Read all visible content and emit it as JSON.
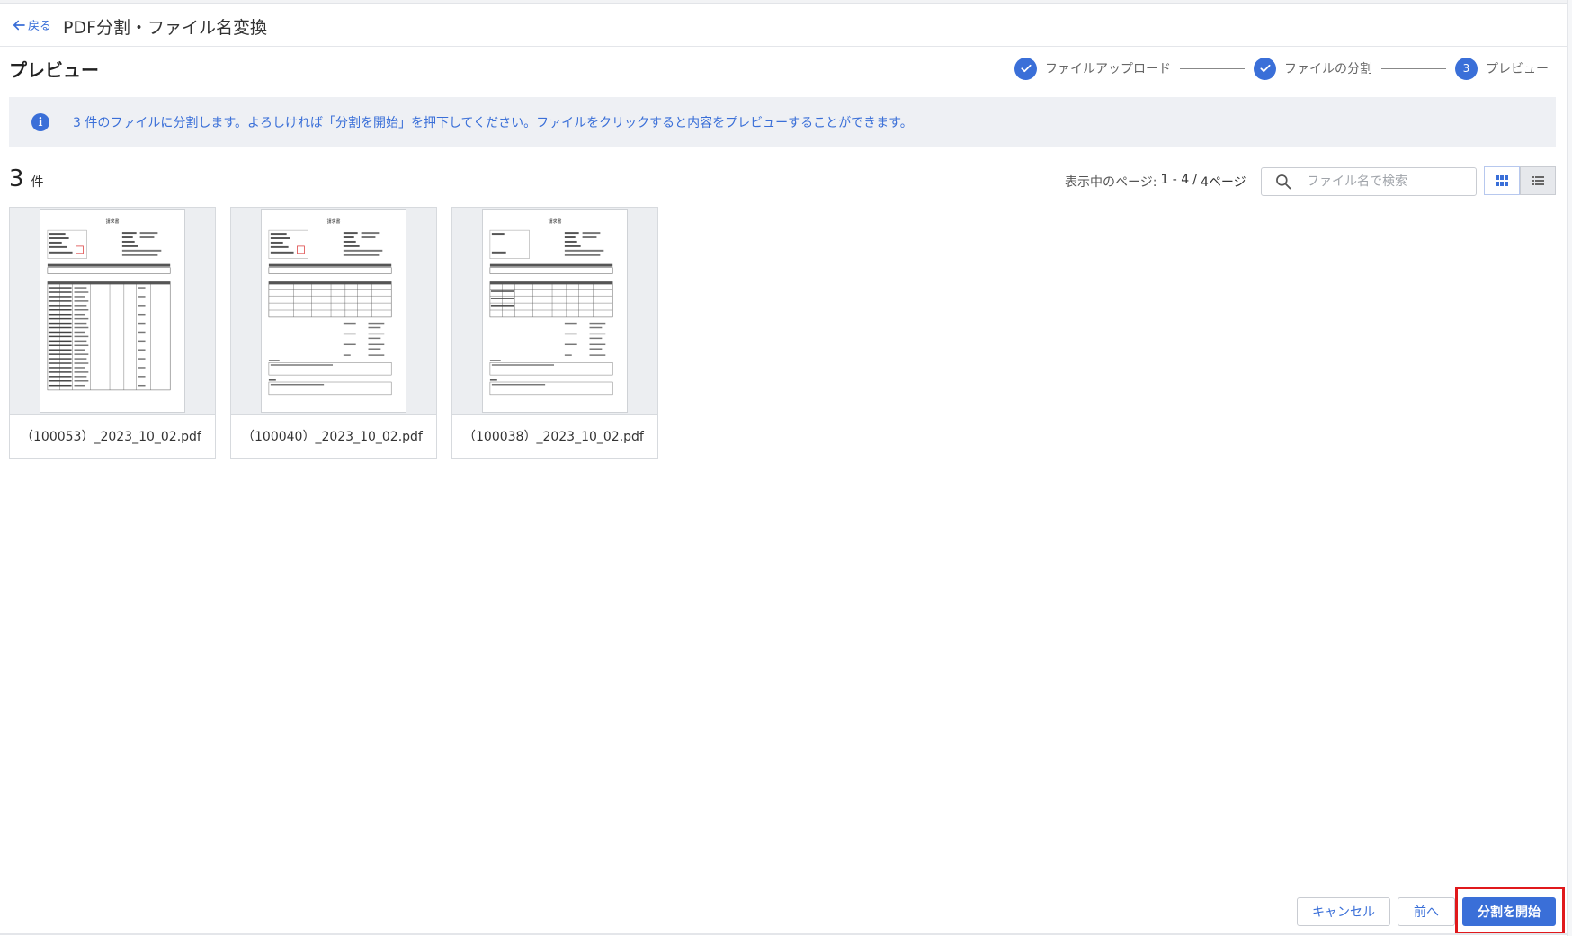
{
  "header": {
    "back_label": "戻る",
    "title": "PDF分割・ファイル名変換"
  },
  "page": {
    "title": "プレビュー"
  },
  "stepper": {
    "steps": [
      {
        "label": "ファイルアップロード",
        "state": "done"
      },
      {
        "label": "ファイルの分割",
        "state": "done"
      },
      {
        "label": "プレビュー",
        "state": "current",
        "number": "3"
      }
    ]
  },
  "info": {
    "message": "3 件のファイルに分割します。よろしければ「分割を開始」を押下してください。ファイルをクリックすると内容をプレビューすることができます。"
  },
  "results": {
    "count": "3",
    "count_unit": "件",
    "page_label": "表示中のページ:",
    "page_range": "1 - 4",
    "page_sep": "/",
    "page_total": "4ページ"
  },
  "search": {
    "placeholder": "ファイル名で検索",
    "value": ""
  },
  "files": [
    {
      "name": "（100053）_2023_10_02.pdf",
      "doc_title": "請求書"
    },
    {
      "name": "（100040）_2023_10_02.pdf",
      "doc_title": "請求書"
    },
    {
      "name": "（100038）_2023_10_02.pdf",
      "doc_title": "請求書"
    }
  ],
  "footer": {
    "cancel_label": "キャンセル",
    "prev_label": "前へ",
    "start_label": "分割を開始"
  },
  "colors": {
    "accent": "#3a6fd8",
    "highlight": "#e0191c",
    "info_bg": "#eef0f4"
  }
}
